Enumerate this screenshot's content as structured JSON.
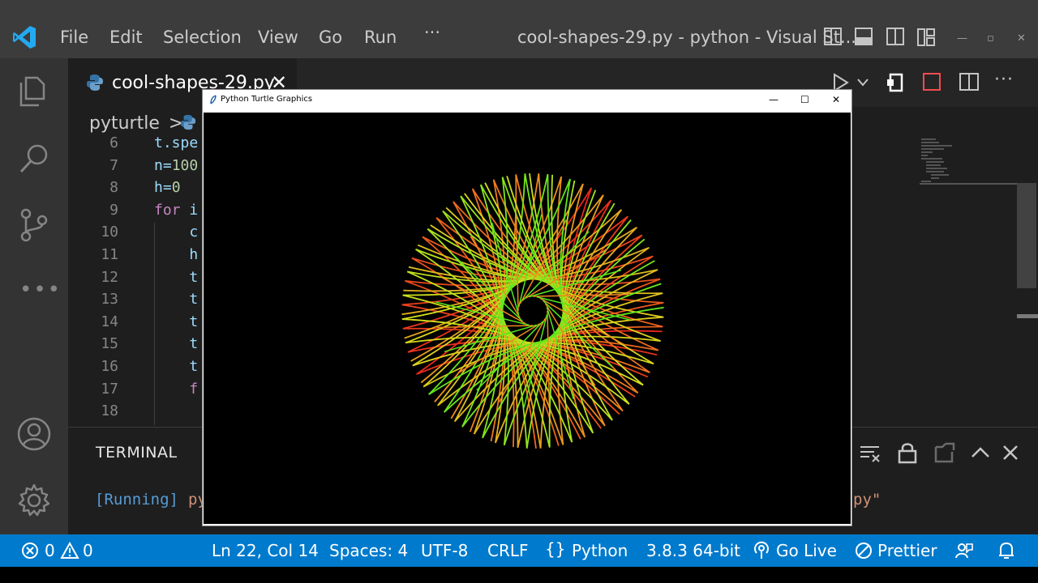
{
  "titlebar": {
    "menu": [
      "File",
      "Edit",
      "Selection",
      "View",
      "Go",
      "Run",
      "···"
    ],
    "window_title": "cool-shapes-29.py - python - Visual St...",
    "icons": [
      "vscode-logo-icon",
      "toggle-sidebar-icon",
      "toggle-panel-icon",
      "toggle-secondary-sidebar-icon",
      "customize-layout-icon",
      "minimize-icon",
      "restore-icon",
      "close-icon"
    ]
  },
  "activity_bar": {
    "icons": [
      "explorer-icon",
      "search-icon",
      "source-control-icon",
      "more-icon",
      "accounts-icon",
      "settings-gear-icon"
    ]
  },
  "tabs": [
    {
      "label": "cool-shapes-29.py",
      "icon": "python-icon"
    }
  ],
  "editor_actions": [
    "run-icon",
    "chevron-down-icon",
    "remote-icon",
    "stop-icon",
    "split-editor-icon",
    "more-actions-icon"
  ],
  "breadcrumb": {
    "folder": "pyturtle",
    "separator": ">"
  },
  "code": {
    "line_numbers": [
      "6",
      "7",
      "8",
      "9",
      "10",
      "11",
      "12",
      "13",
      "14",
      "15",
      "16",
      "17",
      "18"
    ],
    "lines": [
      {
        "kw": "",
        "text": "t.spe",
        "num": ""
      },
      {
        "kw": "",
        "text": "n=",
        "num": "100"
      },
      {
        "kw": "",
        "text": "h=",
        "num": "0"
      },
      {
        "kw": "for",
        "text": " i",
        "num": ""
      },
      {
        "kw": "",
        "text": "    c",
        "num": ""
      },
      {
        "kw": "",
        "text": "    h",
        "num": ""
      },
      {
        "kw": "",
        "text": "    t",
        "num": ""
      },
      {
        "kw": "",
        "text": "    t",
        "num": ""
      },
      {
        "kw": "",
        "text": "    t",
        "num": ""
      },
      {
        "kw": "",
        "text": "    t",
        "num": ""
      },
      {
        "kw": "",
        "text": "    t",
        "num": ""
      },
      {
        "kw": "    f",
        "text": "",
        "num": ""
      },
      {
        "kw": "",
        "text": "",
        "num": ""
      }
    ]
  },
  "terminal": {
    "title": "TERMINAL",
    "running_label": "[Running]",
    "line_start": "py",
    "line_end": "py\"",
    "icons": [
      "clear-terminal-icon",
      "lock-icon",
      "new-window-icon",
      "chevron-up-icon",
      "close-panel-icon"
    ]
  },
  "status_bar": {
    "errors": "0",
    "warnings": "0",
    "position": "Ln 22, Col 14",
    "spaces": "Spaces: 4",
    "encoding": "UTF-8",
    "eol": "CRLF",
    "language": "Python",
    "interpreter": "3.8.3 64-bit",
    "go_live": "Go Live",
    "prettier": "Prettier",
    "icons": [
      "error-icon",
      "warning-icon",
      "language-braces-icon",
      "broadcast-icon",
      "prettier-icon",
      "feedback-icon",
      "bell-icon"
    ]
  },
  "turtle_window": {
    "title": "Python Turtle Graphics",
    "buttons": [
      "minimize-icon",
      "maximize-icon",
      "close-icon"
    ]
  },
  "colors": {
    "accent": "#007acc",
    "titlebar": "#3c3c3c",
    "activity": "#333333",
    "editor_bg": "#1e1e1e",
    "pattern_red": "#e8291c",
    "pattern_orange": "#f08a1c",
    "pattern_yellow": "#d6e01c",
    "pattern_green": "#55e81c"
  }
}
